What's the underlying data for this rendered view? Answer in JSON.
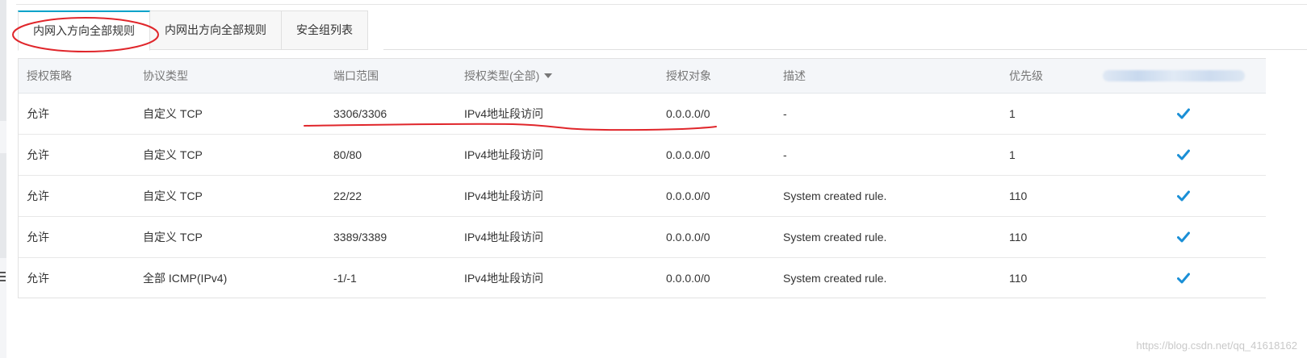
{
  "tabs": [
    {
      "label": "内网入方向全部规则",
      "active": true
    },
    {
      "label": "内网出方向全部规则",
      "active": false
    },
    {
      "label": "安全组列表",
      "active": false
    }
  ],
  "table": {
    "headers": [
      "授权策略",
      "协议类型",
      "端口范围",
      "授权类型(全部)",
      "授权对象",
      "描述",
      "优先级"
    ],
    "rows": [
      {
        "policy": "允许",
        "protocol": "自定义 TCP",
        "port": "3306/3306",
        "auth_type": "IPv4地址段访问",
        "object": "0.0.0.0/0",
        "desc": "-",
        "priority": "1"
      },
      {
        "policy": "允许",
        "protocol": "自定义 TCP",
        "port": "80/80",
        "auth_type": "IPv4地址段访问",
        "object": "0.0.0.0/0",
        "desc": "-",
        "priority": "1"
      },
      {
        "policy": "允许",
        "protocol": "自定义 TCP",
        "port": "22/22",
        "auth_type": "IPv4地址段访问",
        "object": "0.0.0.0/0",
        "desc": "System created rule.",
        "priority": "110"
      },
      {
        "policy": "允许",
        "protocol": "自定义 TCP",
        "port": "3389/3389",
        "auth_type": "IPv4地址段访问",
        "object": "0.0.0.0/0",
        "desc": "System created rule.",
        "priority": "110"
      },
      {
        "policy": "允许",
        "protocol": "全部 ICMP(IPv4)",
        "port": "-1/-1",
        "auth_type": "IPv4地址段访问",
        "object": "0.0.0.0/0",
        "desc": "System created rule.",
        "priority": "110"
      }
    ]
  },
  "icons": {
    "row_status": "check-icon",
    "header_dropdown": "caret-down-icon"
  },
  "colors": {
    "accent": "#00a2ca",
    "check": "#1a8fd6",
    "annotation": "#e0262b"
  },
  "watermark": "https://blog.csdn.net/qq_41618162"
}
